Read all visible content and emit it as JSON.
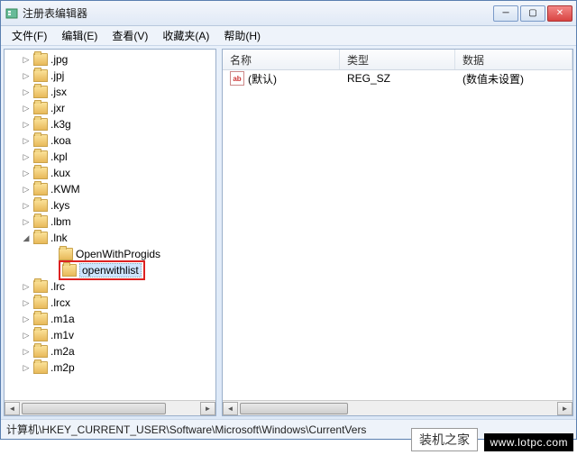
{
  "window": {
    "title": "注册表编辑器"
  },
  "menu": {
    "file": "文件(F)",
    "edit": "编辑(E)",
    "view": "查看(V)",
    "favorites": "收藏夹(A)",
    "help": "帮助(H)"
  },
  "tree": {
    "items": [
      ".jpg",
      ".jpj",
      ".jsx",
      ".jxr",
      ".k3g",
      ".koa",
      ".kpl",
      ".kux",
      ".KWM",
      ".kys",
      ".lbm"
    ],
    "lnk_label": ".lnk",
    "lnk_child1": "OpenWithProgids",
    "lnk_child2": "openwithlist",
    "items2": [
      ".lrc",
      ".lrcx",
      ".m1a",
      ".m1v",
      ".m2a",
      ".m2p"
    ]
  },
  "list": {
    "headers": {
      "name": "名称",
      "type": "类型",
      "data": "数据"
    },
    "row": {
      "name": "(默认)",
      "type": "REG_SZ",
      "data": "(数值未设置)"
    },
    "icon_text": "ab"
  },
  "status": {
    "path": "计算机\\HKEY_CURRENT_USER\\Software\\Microsoft\\Windows\\CurrentVers"
  },
  "watermark": {
    "text1": "装机之家",
    "text2": "www.lotpc.com",
    "mid": ""
  }
}
